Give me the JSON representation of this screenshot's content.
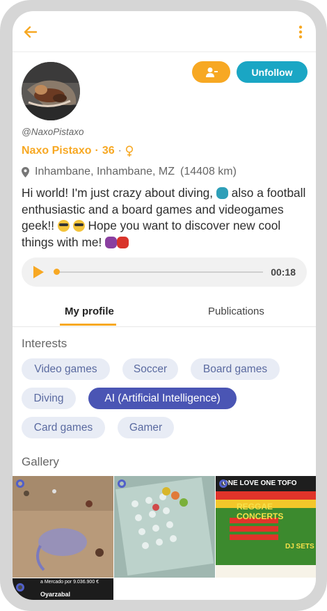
{
  "profile": {
    "handle": "@NaxoPistaxo",
    "name": "Naxo Pistaxo",
    "age": "36",
    "location": "Inhambane, Inhambane, MZ",
    "distance": "(14408 km)",
    "bio_part1": "Hi world! I'm just crazy about diving, ",
    "bio_part2": " also a football enthusiastic and a board games and videogames geek!! ",
    "bio_part3": " Hope you want to discover new cool things with me! "
  },
  "actions": {
    "unfollow_label": "Unfollow"
  },
  "audio": {
    "duration": "00:18",
    "progress": 0.0
  },
  "tabs": [
    {
      "label": "My profile",
      "active": true
    },
    {
      "label": "Publications",
      "active": false
    }
  ],
  "interests": {
    "title": "Interests",
    "chips": [
      {
        "label": "Video games",
        "selected": false
      },
      {
        "label": "Soccer",
        "selected": false
      },
      {
        "label": "Board games",
        "selected": false
      },
      {
        "label": "Diving",
        "selected": false
      },
      {
        "label": "AI (Artificial Intelligence)",
        "selected": true
      },
      {
        "label": "Card games",
        "selected": false
      },
      {
        "label": "Gamer",
        "selected": false
      }
    ]
  },
  "gallery": {
    "title": "Gallery",
    "poster_top": "ONE LOVE ONE TOFO",
    "poster_title": "REGGAE CONCERTS",
    "poster_side": "DJ SETS",
    "thumb4_line1": "a Mercado por 9.036.900 €",
    "thumb4_line2": "Oyarzabal"
  },
  "colors": {
    "accent": "#f7a823",
    "unfollow": "#1aa6c4",
    "chip_bg": "#e8ecf5",
    "chip_selected": "#4a55b4"
  },
  "icons": {
    "back": "arrow-left-icon",
    "more": "more-vertical-icon",
    "add_friend": "person-add-icon",
    "gender": "female-icon",
    "location": "location-pin-icon",
    "play": "play-icon"
  }
}
